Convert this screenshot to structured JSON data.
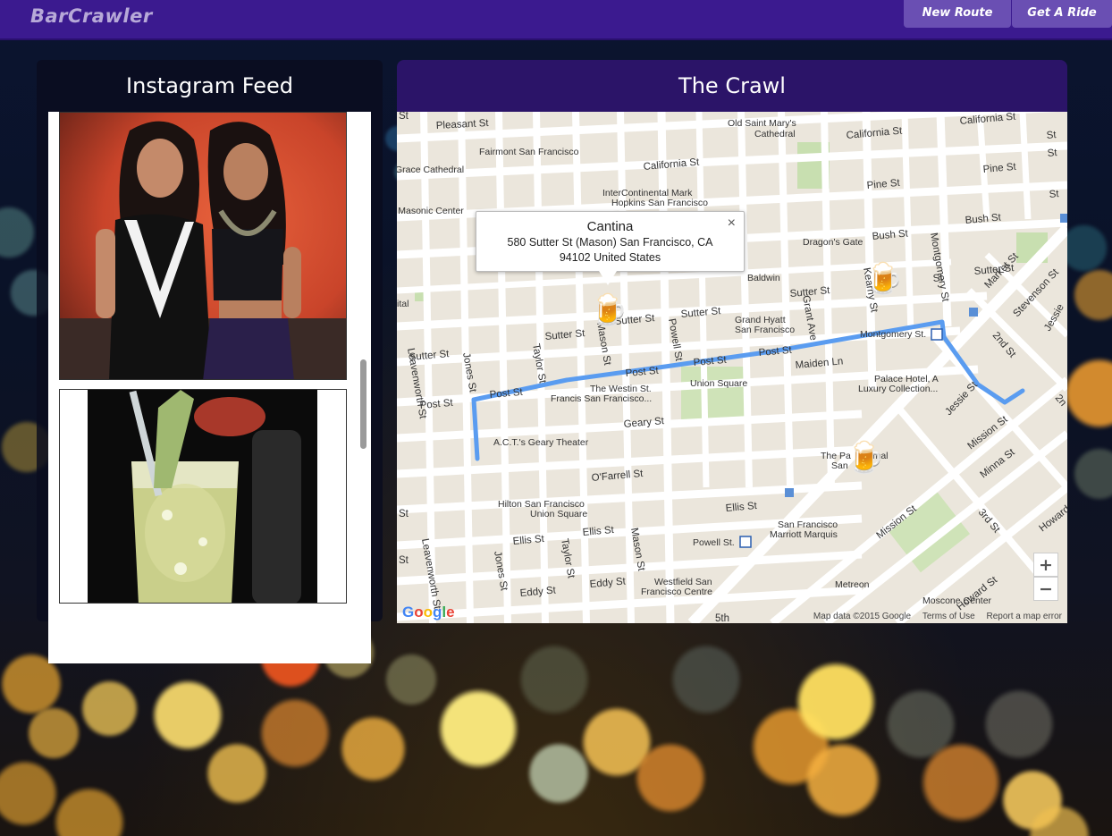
{
  "app": {
    "brand": "BarCrawler",
    "nav": [
      "New Route",
      "Get A Ride"
    ]
  },
  "feed": {
    "title": "Instagram Feed",
    "photos": [
      "photo-two-women",
      "photo-cocktail"
    ]
  },
  "crawl": {
    "title": "The Crawl",
    "infowindow": {
      "name": "Cantina",
      "address_line1": "580 Sutter St (Mason) San Francisco, CA",
      "address_line2": "94102 United States",
      "close": "×"
    },
    "streets": {
      "pleasant": "Pleasant St",
      "california1": "California St",
      "california2": "California St",
      "california3": "California St",
      "pine1": "Pine St",
      "pine2": "Pine St",
      "bush": "Bush St",
      "sutter1": "Sutter St",
      "sutter2": "Sutter St",
      "sutter3": "Sutter St",
      "sutter4": "Sutter St",
      "sutter5": "Sutter St",
      "sutter6": "Sutter St",
      "post1": "Post St",
      "post2": "Post St",
      "post3": "Post St",
      "post4": "Post St",
      "post5": "Post St",
      "geary": "Geary St",
      "ofarrell": "O'Farrell St",
      "ellis1": "Ellis St",
      "ellis2": "Ellis St",
      "ellis3": "Ellis St",
      "eddy1": "Eddy St",
      "eddy2": "Eddy St",
      "jones1": "Jones St",
      "jones2": "Jones St",
      "taylor1": "Taylor St",
      "taylor2": "Taylor St",
      "mason1": "Mason St",
      "mason2": "Mason St",
      "powell": "Powell St",
      "grant": "Grant Ave",
      "kearny": "Kearny St",
      "montgomery": "Montgomery St",
      "leavenworth1": "Leavenworth St",
      "leavenworth2": "Leavenworth St",
      "maiden": "Maiden Ln",
      "market": "Market St",
      "second": "2nd St",
      "third": "3rd St",
      "jessie": "Jessie St",
      "mission1": "Mission St",
      "mission2": "Mission St",
      "minna": "Minna St",
      "howard1": "Howard St",
      "howard2": "Howard St",
      "stevenson": "Stevenson St",
      "baldwin": "Baldwin",
      "st_a": "St",
      "st_b": "St",
      "st_c": "St",
      "st_d": "St",
      "st_e": "St",
      "st_f": "St",
      "st_g": "St",
      "fifth": "5th",
      "second_b": "2n",
      "jessie_b": "Jessie"
    },
    "pois": {
      "old_st_marys": "Old Saint Mary's",
      "cathedral": "Cathedral",
      "fairmont": "Fairmont San Francisco",
      "grace": "Grace Cathedral",
      "intercontinental1": "InterContinental Mark",
      "intercontinental2": "Hopkins San Francisco",
      "masonic": "l Masonic Center",
      "dragons_gate": "Dragon's Gate",
      "grand_hyatt1": "Grand Hyatt",
      "grand_hyatt2": "San Francisco",
      "westin1": "The Westin St.",
      "westin2": "Francis San Francisco...",
      "union_square": "Union Square",
      "act": "A.C.T.'s Geary Theater",
      "palace1": "Palace Hotel, A",
      "palace2": "Luxury Collection...",
      "montgomery_station": "Montgomery St.",
      "palace_hotel_b1": "The Pa",
      "palace_hotel_b2": "rnal",
      "palace_hotel_b3": "San",
      "hilton1": "Hilton San Francisco",
      "hilton2": "Union Square",
      "marriott1": "San Francisco",
      "marriott2": "Marriott Marquis",
      "powell_station": "Powell St.",
      "westfield1": "Westfield San",
      "westfield2": "Francisco Centre",
      "metreon": "Metreon",
      "moscone": "Moscone Center",
      "ital": "ital"
    },
    "zoom_in": "+",
    "zoom_out": "−",
    "footer": {
      "attribution": "Map data ©2015 Google",
      "terms": "Terms of Use",
      "report": "Report a map error"
    },
    "logo_letters": [
      "G",
      "o",
      "o",
      "g",
      "l",
      "e"
    ],
    "colors": {
      "route": "#5a9cf0",
      "map_bg": "#ebe6dc",
      "header": "#2b1468",
      "navbar": "#3b1a8f"
    }
  }
}
